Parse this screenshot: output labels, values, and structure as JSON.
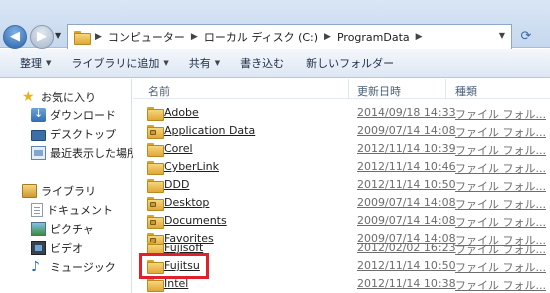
{
  "address": {
    "crumbs": [
      "コンピューター",
      "ローカル ディスク (C:)",
      "ProgramData"
    ]
  },
  "toolbar": {
    "organize": "整理",
    "include_library": "ライブラリに追加",
    "share": "共有",
    "burn": "書き込む",
    "new_folder": "新しいフォルダー"
  },
  "nav": {
    "favorites": "お気に入り",
    "downloads": "ダウンロード",
    "desktop": "デスクトップ",
    "recent": "最近表示した場所",
    "libraries": "ライブラリ",
    "documents": "ドキュメント",
    "pictures": "ピクチャ",
    "videos": "ビデオ",
    "music": "ミュージック"
  },
  "columns": {
    "name": "名前",
    "date": "更新日時",
    "type": "種類"
  },
  "files": [
    {
      "name": "Adobe",
      "date": "2014/09/18 14:33",
      "type": "ファイル フォル..."
    },
    {
      "name": "Application Data",
      "date": "2009/07/14 14:08",
      "type": "ファイル フォル..."
    },
    {
      "name": "Corel",
      "date": "2012/11/14 10:39",
      "type": "ファイル フォル..."
    },
    {
      "name": "CyberLink",
      "date": "2012/11/14 10:46",
      "type": "ファイル フォル..."
    },
    {
      "name": "DDD",
      "date": "2012/11/14 10:50",
      "type": "ファイル フォル..."
    },
    {
      "name": "Desktop",
      "date": "2009/07/14 14:08",
      "type": "ファイル フォル..."
    },
    {
      "name": "Documents",
      "date": "2009/07/14 14:08",
      "type": "ファイル フォル..."
    },
    {
      "name": "Favorites",
      "date": "2009/07/14 14:08",
      "type": "ファイル フォル..."
    },
    {
      "name": "Fujisoft",
      "date": "2012/02/02 16:23",
      "type": "ファイル フォル..."
    },
    {
      "name": "Fujitsu",
      "date": "2012/11/14 10:50",
      "type": "ファイル フォル..."
    },
    {
      "name": "Intel",
      "date": "2012/11/14 10:38",
      "type": "ファイル フォル..."
    }
  ],
  "colors": {
    "highlight": "#e0202a",
    "link_blue": "#1e4fb2"
  }
}
